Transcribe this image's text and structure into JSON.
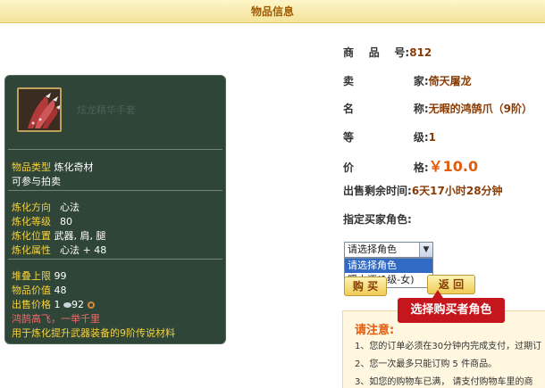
{
  "header": {
    "title": "物品信息"
  },
  "item": {
    "name": "炫龙精华手套",
    "type_label": "物品类型",
    "type_value": "炼化奇材",
    "auction": "可参与拍卖",
    "refine_dir_label": "炼化方向",
    "refine_dir_value": "心法",
    "refine_level_label": "炼化等级",
    "refine_level_value": "80",
    "refine_pos_label": "炼化位置",
    "refine_pos_value": "武器, 肩, 腿",
    "refine_attr_label": "炼化属性",
    "refine_attr_value": "心法 + 48",
    "stack_label": "堆叠上限",
    "stack_value": "99",
    "item_value_label": "物品价值",
    "item_value_value": "48",
    "sell_price_label": "出售价格",
    "sell_price_a": "1",
    "sell_price_b": "92",
    "quote": "鸿鹄高飞，一举千里",
    "desc": "用于炼化提升武器装备的9阶传说材料"
  },
  "info": {
    "id_label": "商    品    号:",
    "id_value": "812",
    "seller_label": "卖                家:",
    "seller_value": "倚天屠龙",
    "name_label": "名                称:",
    "name_value": "无暇的鸿鹄爪（9阶）",
    "level_label": "等                级:",
    "level_value": "1",
    "price_label": "价                格:",
    "price_value": "￥10.0",
    "remain_label": "出售剩余时间:",
    "remain_value": "6天17小时28分钟",
    "buyer_label": "指定买家角色:"
  },
  "select": {
    "current": "请选择角色",
    "options": [
      "请选择角色",
      "暖水瓶(1级-女)"
    ]
  },
  "buttons": {
    "buy": "购 买",
    "back": "返 回"
  },
  "callout": "选择购买者角色",
  "notice": {
    "title": "请注意:",
    "lines": [
      "1、您的订单必须在30分钟内完成支付，过期订",
      "2、您一次最多只能订购 5 件商品。",
      "3、如您的购物车已满， 请支付购物车里的商"
    ]
  },
  "colors": {
    "accent": "#e35c0c",
    "card_bg": "#2f4538",
    "label_yellow": "#f7d23b",
    "callout_red": "#c4161c"
  }
}
